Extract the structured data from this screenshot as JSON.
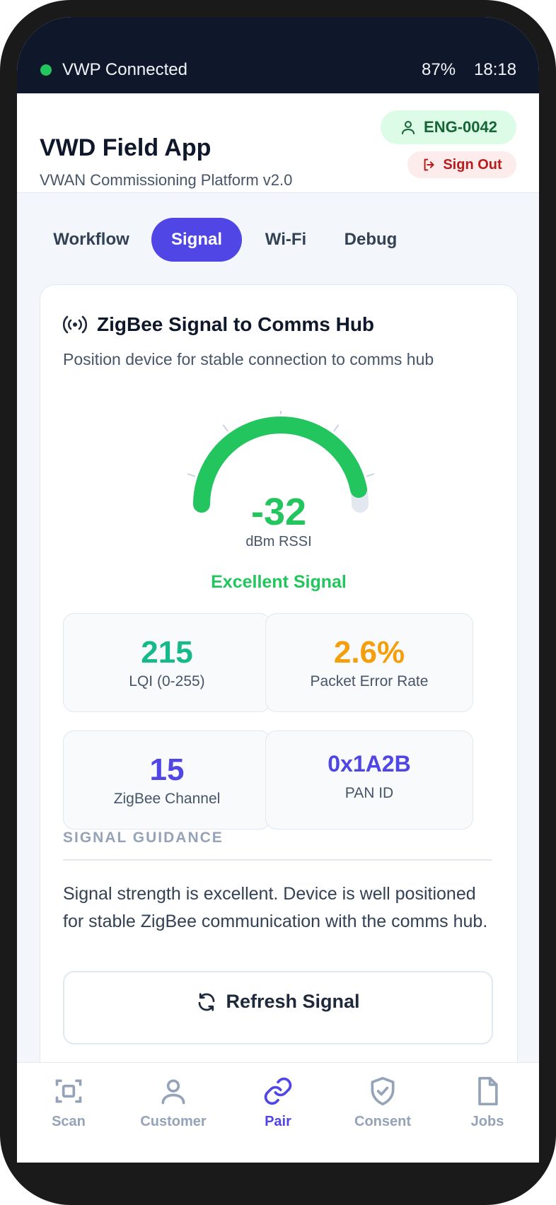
{
  "status_bar": {
    "connection": "VWP Connected",
    "battery": "87%",
    "time": "18:18",
    "connection_color": "#22c55e"
  },
  "header": {
    "title": "VWD Field App",
    "subtitle": "VWAN Commissioning Platform v2.0",
    "engineer_id": "ENG-0042",
    "sign_out": "Sign Out"
  },
  "tabs": [
    {
      "label": "Workflow",
      "active": false
    },
    {
      "label": "Signal",
      "active": true
    },
    {
      "label": "Wi-Fi",
      "active": false
    },
    {
      "label": "Debug",
      "active": false
    }
  ],
  "signal_card": {
    "icon": "radio-signal-icon",
    "title": "ZigBee Signal to Comms Hub",
    "subtitle": "Position device for stable connection to comms hub",
    "rssi_value": "-32",
    "rssi_unit": "dBm RSSI",
    "gauge_fill_fraction": 0.94,
    "quality": "Excellent Signal",
    "stats": [
      {
        "value": "215",
        "label": "LQI (0-255)",
        "color": "#16b98a"
      },
      {
        "value": "2.6%",
        "label": "Packet Error Rate",
        "color": "#f59e0b"
      },
      {
        "value": "15",
        "label": "ZigBee Channel",
        "color": "#4f46e5"
      },
      {
        "value": "0x1A2B",
        "label": "PAN ID",
        "color": "#4f46e5"
      }
    ],
    "guidance_heading": "SIGNAL GUIDANCE",
    "guidance_text": "Signal strength is excellent. Device is well positioned for stable ZigBee communication with the comms hub.",
    "refresh_label": "Refresh Signal"
  },
  "bottom_nav": [
    {
      "label": "Scan",
      "icon": "scan-icon",
      "active": false
    },
    {
      "label": "Customer",
      "icon": "user-icon",
      "active": false
    },
    {
      "label": "Pair",
      "icon": "link-icon",
      "active": true
    },
    {
      "label": "Consent",
      "icon": "shield-check-icon",
      "active": false
    },
    {
      "label": "Jobs",
      "icon": "document-icon",
      "active": false
    }
  ],
  "colors": {
    "accent": "#4f46e5",
    "success": "#22c55e",
    "warning": "#f59e0b",
    "danger": "#b91c1c"
  }
}
